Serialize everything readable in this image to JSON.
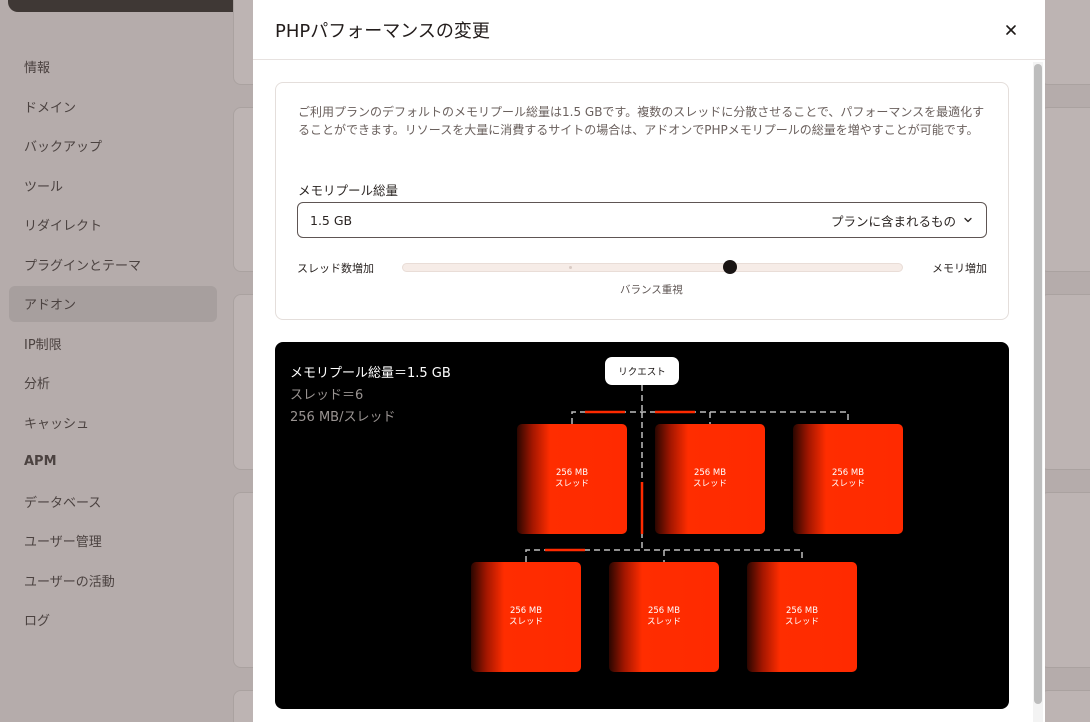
{
  "sidebar": {
    "items": [
      {
        "label": "情報",
        "active": false
      },
      {
        "label": "ドメイン",
        "active": false
      },
      {
        "label": "バックアップ",
        "active": false
      },
      {
        "label": "ツール",
        "active": false
      },
      {
        "label": "リダイレクト",
        "active": false
      },
      {
        "label": "プラグインとテーマ",
        "active": false
      },
      {
        "label": "アドオン",
        "active": true
      },
      {
        "label": "IP制限",
        "active": false
      },
      {
        "label": "分析",
        "active": false
      },
      {
        "label": "キャッシュ",
        "active": false
      },
      {
        "label": "APM",
        "active": false
      },
      {
        "label": "データベース",
        "active": false
      },
      {
        "label": "ユーザー管理",
        "active": false
      },
      {
        "label": "ユーザーの活動",
        "active": false
      },
      {
        "label": "ログ",
        "active": false
      }
    ]
  },
  "modal": {
    "title": "PHPパフォーマンスの変更",
    "close_icon": "close-icon",
    "description": "ご利用プランのデフォルトのメモリプール総量は1.5 GBです。複数のスレッドに分散させることで、パフォーマンスを最適化することができます。リソースを大量に消費するサイトの場合は、アドオンでPHPメモリプールの総量を増やすことが可能です。",
    "memory_pool": {
      "label": "メモリプール総量",
      "value": "1.5 GB",
      "included_text": "プランに含まれるもの",
      "chevron_icon": "chevron-down-icon"
    },
    "slider": {
      "left_label": "スレッド数増加",
      "right_label": "メモリ増加",
      "caption": "バランス重視",
      "position_fraction": 0.66
    },
    "diagram": {
      "summary_total": "メモリプール総量＝1.5 GB",
      "summary_threads": "スレッド＝6",
      "summary_per_thread": "256 MB/スレッド",
      "request_label": "リクエスト",
      "threads": [
        {
          "size": "256 MB",
          "label": "スレッド"
        },
        {
          "size": "256 MB",
          "label": "スレッド"
        },
        {
          "size": "256 MB",
          "label": "スレッド"
        },
        {
          "size": "256 MB",
          "label": "スレッド"
        },
        {
          "size": "256 MB",
          "label": "スレッド"
        },
        {
          "size": "256 MB",
          "label": "スレッド"
        }
      ]
    }
  },
  "colors": {
    "thread_red": "#ff2a00",
    "diagram_bg": "#000000",
    "slider_thumb": "#1a1514"
  }
}
